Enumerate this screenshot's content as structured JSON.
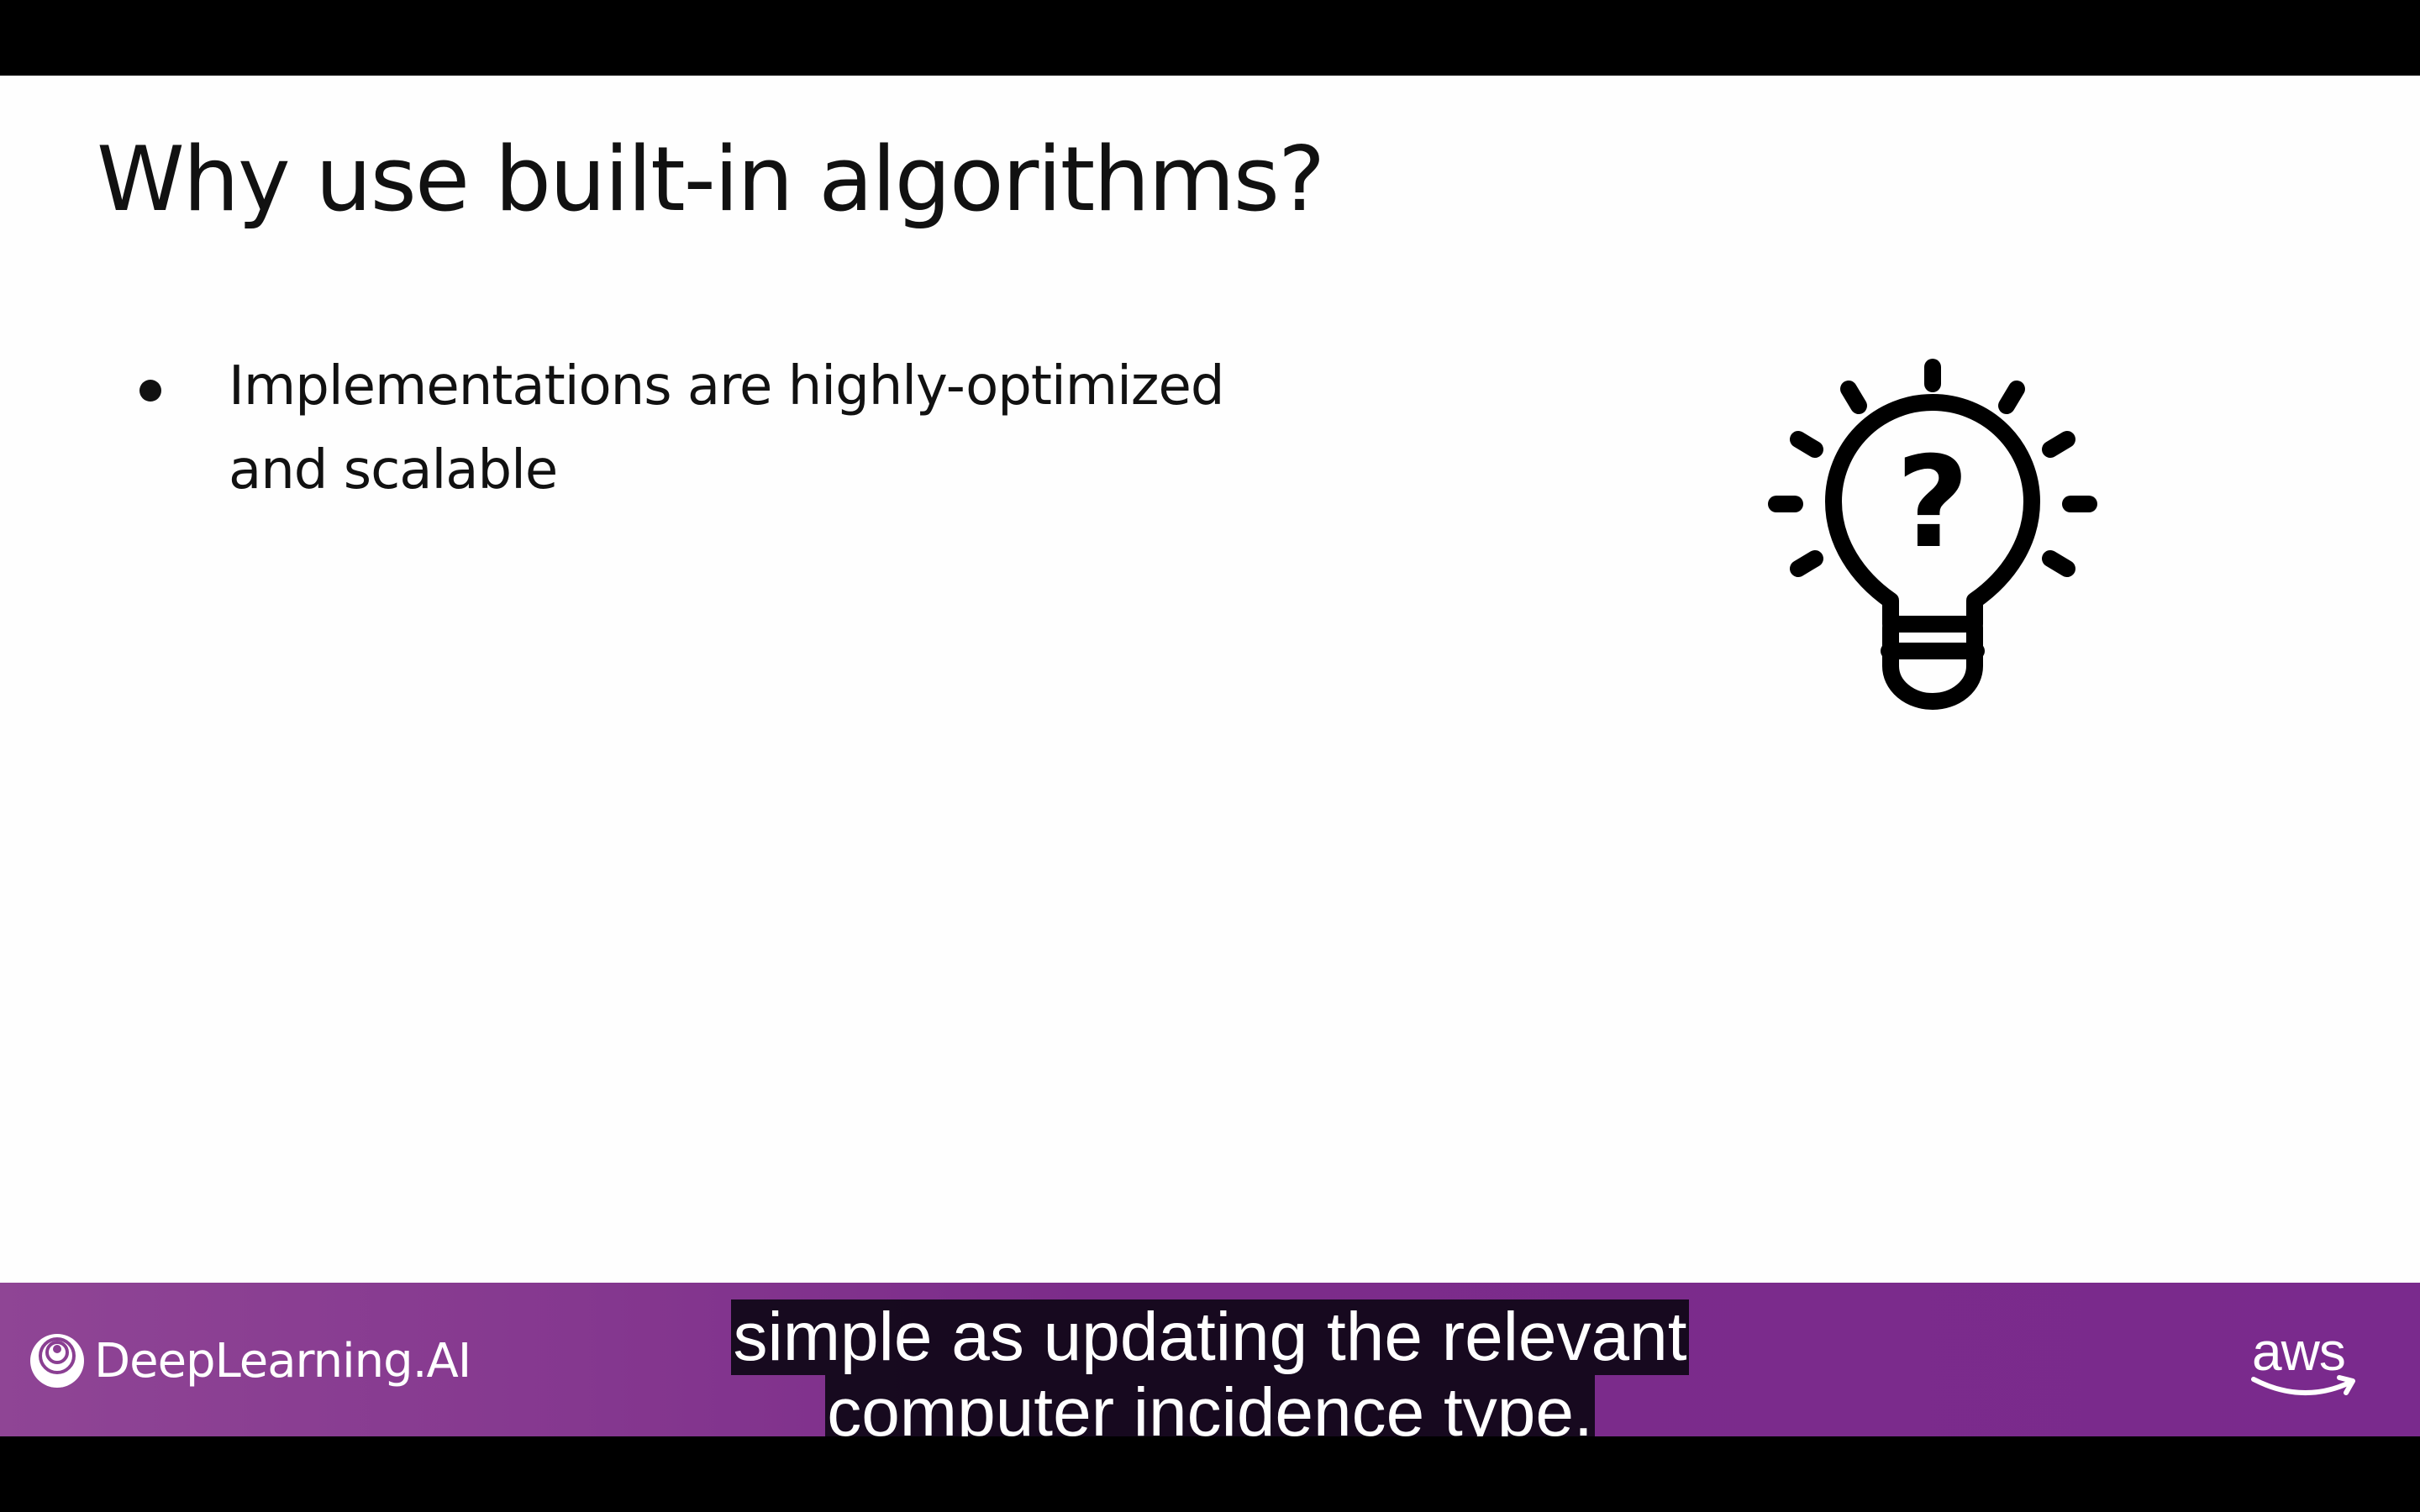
{
  "slide": {
    "title": "Why use built-in algorithms?",
    "bullets": [
      {
        "line1": "Implementations are highly-optimized",
        "line2": "and scalable"
      }
    ],
    "illustration": "lightbulb-question-icon"
  },
  "footer": {
    "left_logo_text": "DeepLearning.AI",
    "left_logo_icon": "deeplearning-ai-icon",
    "right_logo_text": "aws",
    "right_logo_icon": "aws-smile-icon",
    "bar_color": "#7c2c8a"
  },
  "captions": {
    "line1": "simple as updating the relevant",
    "line2": "computer incidence type."
  }
}
